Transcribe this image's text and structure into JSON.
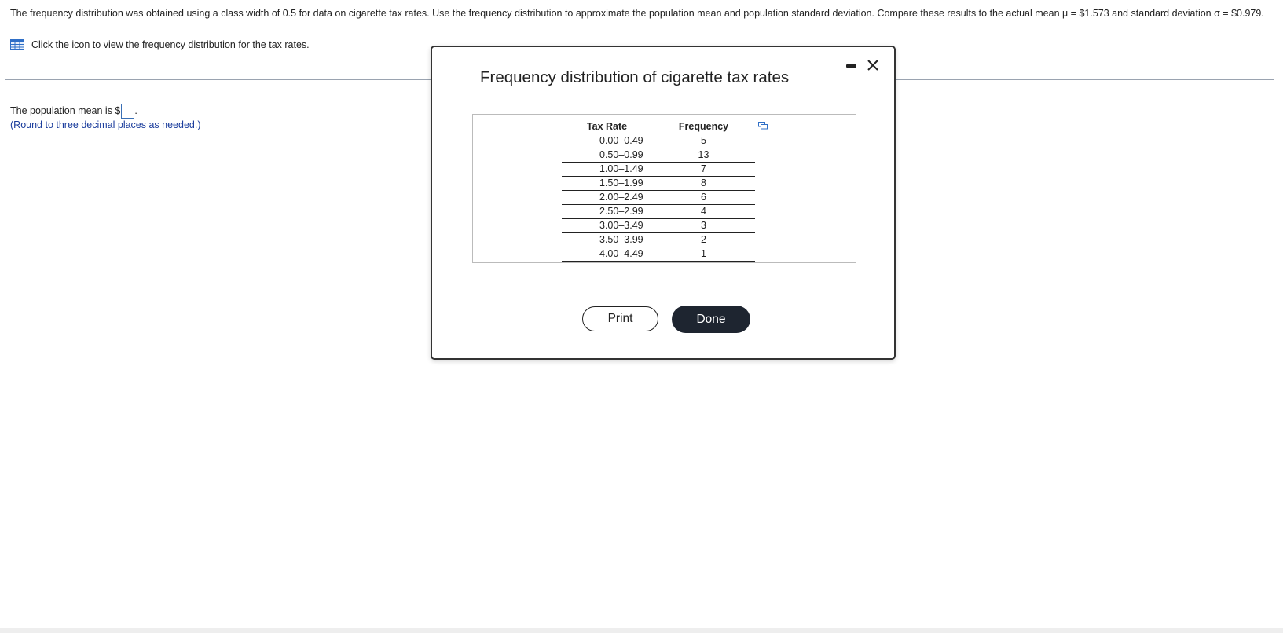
{
  "question": {
    "text": "The frequency distribution was obtained using a class width of 0.5 for data on cigarette tax rates. Use the frequency distribution to approximate the population mean and population standard deviation. Compare these results to the actual mean μ = $1.573 and standard deviation σ = $0.979.",
    "icon_prompt": "Click the icon to view the frequency distribution for the tax rates."
  },
  "answer": {
    "prefix": "The population mean is $",
    "suffix": ".",
    "input_value": "",
    "round_note": "(Round to three decimal places as needed.)"
  },
  "modal": {
    "title": "Frequency distribution of cigarette tax rates",
    "table": {
      "headers": [
        "Tax Rate",
        "Frequency"
      ],
      "rows": [
        {
          "rate": "0.00–0.49",
          "frequency": "5"
        },
        {
          "rate": "0.50–0.99",
          "frequency": "13"
        },
        {
          "rate": "1.00–1.49",
          "frequency": "7"
        },
        {
          "rate": "1.50–1.99",
          "frequency": "8"
        },
        {
          "rate": "2.00–2.49",
          "frequency": "6"
        },
        {
          "rate": "2.50–2.99",
          "frequency": "4"
        },
        {
          "rate": "3.00–3.49",
          "frequency": "3"
        },
        {
          "rate": "3.50–3.99",
          "frequency": "2"
        },
        {
          "rate": "4.00–4.49",
          "frequency": "1"
        }
      ]
    },
    "print_label": "Print",
    "done_label": "Done"
  },
  "colors": {
    "accent_blue": "#1a3c9c",
    "done_button": "#1e2530"
  }
}
